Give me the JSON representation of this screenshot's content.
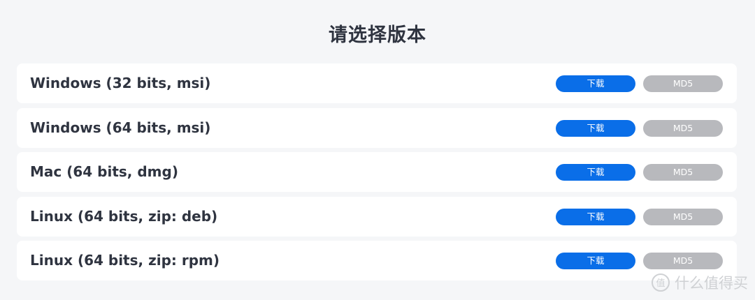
{
  "page": {
    "title": "请选择版本"
  },
  "versions": [
    {
      "label": "Windows (32 bits, msi)",
      "download": "下载",
      "md5": "MD5"
    },
    {
      "label": "Windows (64 bits, msi)",
      "download": "下载",
      "md5": "MD5"
    },
    {
      "label": "Mac (64 bits, dmg)",
      "download": "下载",
      "md5": "MD5"
    },
    {
      "label": "Linux (64 bits, zip: deb)",
      "download": "下载",
      "md5": "MD5"
    },
    {
      "label": "Linux (64 bits, zip: rpm)",
      "download": "下载",
      "md5": "MD5"
    }
  ],
  "colors": {
    "background": "#f5f6f8",
    "card": "#ffffff",
    "text": "#2f3440",
    "download_button": "#0a6ee8",
    "md5_button": "#b8b9bd"
  },
  "watermark": {
    "text": "什么值得买",
    "icon": "smzdm-logo-icon"
  }
}
